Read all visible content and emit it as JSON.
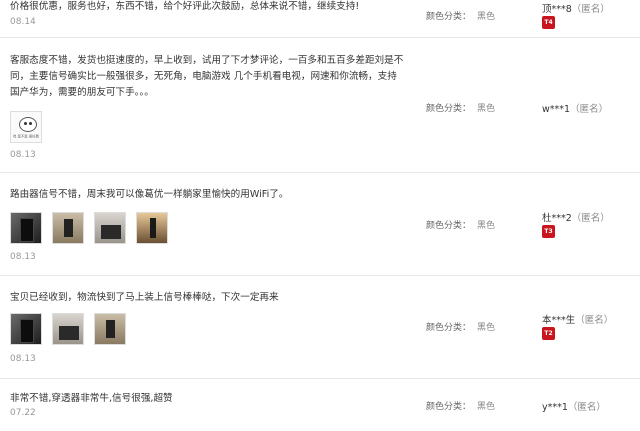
{
  "color_label": "颜色分类：",
  "color_value": "黑色",
  "anon_label": "（匿名）",
  "reviews": [
    {
      "text": "价格很优惠，服务也好，东西不错，给个好评此次鼓励，总体来说不错，继续支持!",
      "date": "08.14",
      "user": "顶***8",
      "badge": "T4"
    },
    {
      "text": "客服态度不错，发货也挺速度的，早上收到，试用了下才梦评论，一百多和五百多差距刘是不同，主要信号确实比一般强很多，无死角，电脑游戏 几个手机看电视，网速和你流畅，支持国产华为，需要的朋友可下手。。。",
      "date": "08.13",
      "user": "w***1",
      "badge": "",
      "image_caption": "哇 是不是 很好看"
    },
    {
      "text": "路由器信号不错，周末我可以像葛优一样躺家里愉快的用WiFi了。",
      "date": "08.13",
      "user": "杜***2",
      "badge": "T3"
    },
    {
      "text": "宝贝已经收到，物流快到了马上装上信号棒棒哒，下次一定再来",
      "date": "08.13",
      "user": "本***生",
      "badge": "T2"
    },
    {
      "text": "非常不错,穿透器非常牛,信号很强,超赞",
      "date": "07.22",
      "user": "y***1",
      "badge": ""
    }
  ]
}
